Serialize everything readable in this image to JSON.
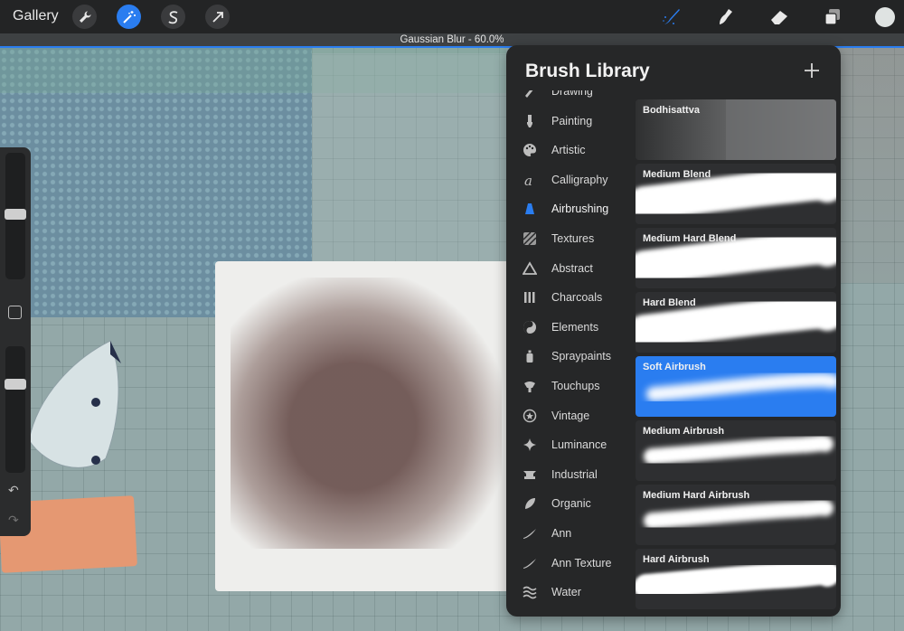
{
  "topbar": {
    "gallery_label": "Gallery",
    "left_tools": [
      {
        "name": "wrench-icon",
        "active": false
      },
      {
        "name": "magic-wand-icon",
        "active": true
      },
      {
        "name": "selection-s-icon",
        "active": false
      },
      {
        "name": "transform-arrow-icon",
        "active": false
      }
    ],
    "right_tools": [
      "brush-icon",
      "smudge-icon",
      "eraser-icon",
      "layers-icon"
    ],
    "accent": "#2a7df0",
    "current_color": "#dfe3e2"
  },
  "adjustment": {
    "label": "Gaussian Blur -  60.0%",
    "value_percent": 60.0
  },
  "sidebar": {
    "brush_size_level": 0.3,
    "opacity_level": 0.3,
    "undo_glyph": "↶",
    "redo_glyph": "↷"
  },
  "brush_library": {
    "title": "Brush Library",
    "add_glyph": "+",
    "categories": [
      {
        "label": "Drawing",
        "icon": "pencil-icon"
      },
      {
        "label": "Painting",
        "icon": "paintbrush-icon"
      },
      {
        "label": "Artistic",
        "icon": "palette-icon"
      },
      {
        "label": "Calligraphy",
        "icon": "calligraphy-icon"
      },
      {
        "label": "Airbrushing",
        "icon": "airbrush-icon",
        "selected": true
      },
      {
        "label": "Textures",
        "icon": "texture-icon"
      },
      {
        "label": "Abstract",
        "icon": "triangle-icon"
      },
      {
        "label": "Charcoals",
        "icon": "charcoal-icon"
      },
      {
        "label": "Elements",
        "icon": "yin-yang-icon"
      },
      {
        "label": "Spraypaints",
        "icon": "spray-can-icon"
      },
      {
        "label": "Touchups",
        "icon": "touchup-icon"
      },
      {
        "label": "Vintage",
        "icon": "star-badge-icon"
      },
      {
        "label": "Luminance",
        "icon": "sparkle-icon"
      },
      {
        "label": "Industrial",
        "icon": "anvil-icon"
      },
      {
        "label": "Organic",
        "icon": "leaf-icon"
      },
      {
        "label": "Ann",
        "icon": "stroke-icon"
      },
      {
        "label": "Ann Texture",
        "icon": "stroke-icon"
      },
      {
        "label": "Water",
        "icon": "waves-icon"
      }
    ],
    "brushes": [
      {
        "label": "Bodhisattva",
        "preview": "texture"
      },
      {
        "label": "Medium Blend",
        "preview": "blend"
      },
      {
        "label": "Medium Hard Blend",
        "preview": "blend"
      },
      {
        "label": "Hard Blend",
        "preview": "blend"
      },
      {
        "label": "Soft Airbrush",
        "preview": "soft",
        "selected": true
      },
      {
        "label": "Medium Airbrush",
        "preview": "airbrush"
      },
      {
        "label": "Medium Hard Airbrush",
        "preview": "airbrush"
      },
      {
        "label": "Hard Airbrush",
        "preview": "hard"
      }
    ]
  }
}
